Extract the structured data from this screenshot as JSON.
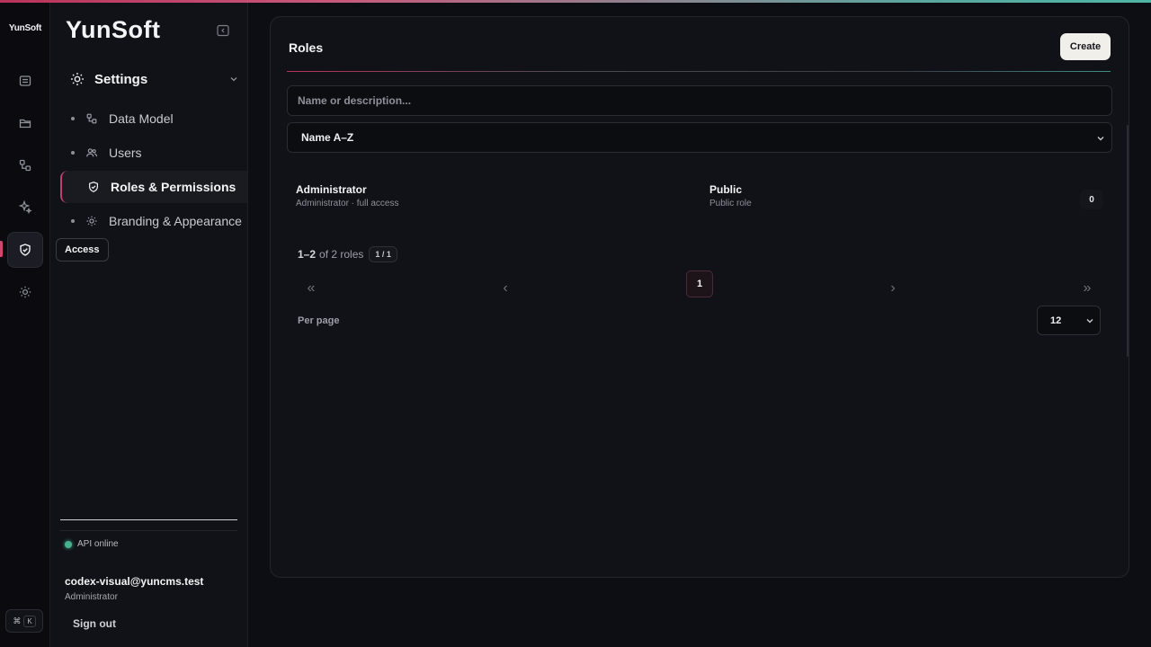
{
  "app": {
    "rail_logo": "YunSoft",
    "brand": "YunSoft",
    "tooltip": "Access",
    "shortcut": {
      "mod": "⌘",
      "key": "K"
    }
  },
  "rail": {
    "items": [
      {
        "icon": "document-icon"
      },
      {
        "icon": "folder-icon"
      },
      {
        "icon": "data-model-icon"
      },
      {
        "icon": "sparkle-icon"
      },
      {
        "icon": "shield-icon",
        "active": true
      },
      {
        "icon": "gear-icon"
      }
    ]
  },
  "sidebar": {
    "section": {
      "label": "Settings",
      "icon": "gear-icon"
    },
    "items": [
      {
        "label": "Data Model",
        "icon": "data-model-icon"
      },
      {
        "label": "Users",
        "icon": "users-icon"
      },
      {
        "label": "Roles & Permissions",
        "icon": "shield-icon",
        "active": true
      },
      {
        "label": "Branding & Appearance",
        "icon": "gear-icon"
      }
    ],
    "api_status": "API online",
    "api_status_color": "#47b08f",
    "user": {
      "email": "codex-visual@yuncms.test",
      "role": "Administrator"
    },
    "sign_out": "Sign out"
  },
  "main": {
    "title": "Roles",
    "create_label": "Create",
    "search_placeholder": "Name or description...",
    "sort": {
      "selected": "Name A–Z"
    },
    "roles": [
      {
        "name": "Administrator",
        "description": "Administrator · full access"
      },
      {
        "name": "Public",
        "description": "Public role",
        "count": "0"
      }
    ],
    "pagination": {
      "range": "1–2",
      "range_suffix": "of 2 roles",
      "page_badge": "1 / 1",
      "first": "«",
      "prev": "‹",
      "current": "1",
      "next": "›",
      "last": "»",
      "per_page_label": "Per page",
      "per_page_value": "12"
    },
    "accent_color": "#c2416a"
  }
}
